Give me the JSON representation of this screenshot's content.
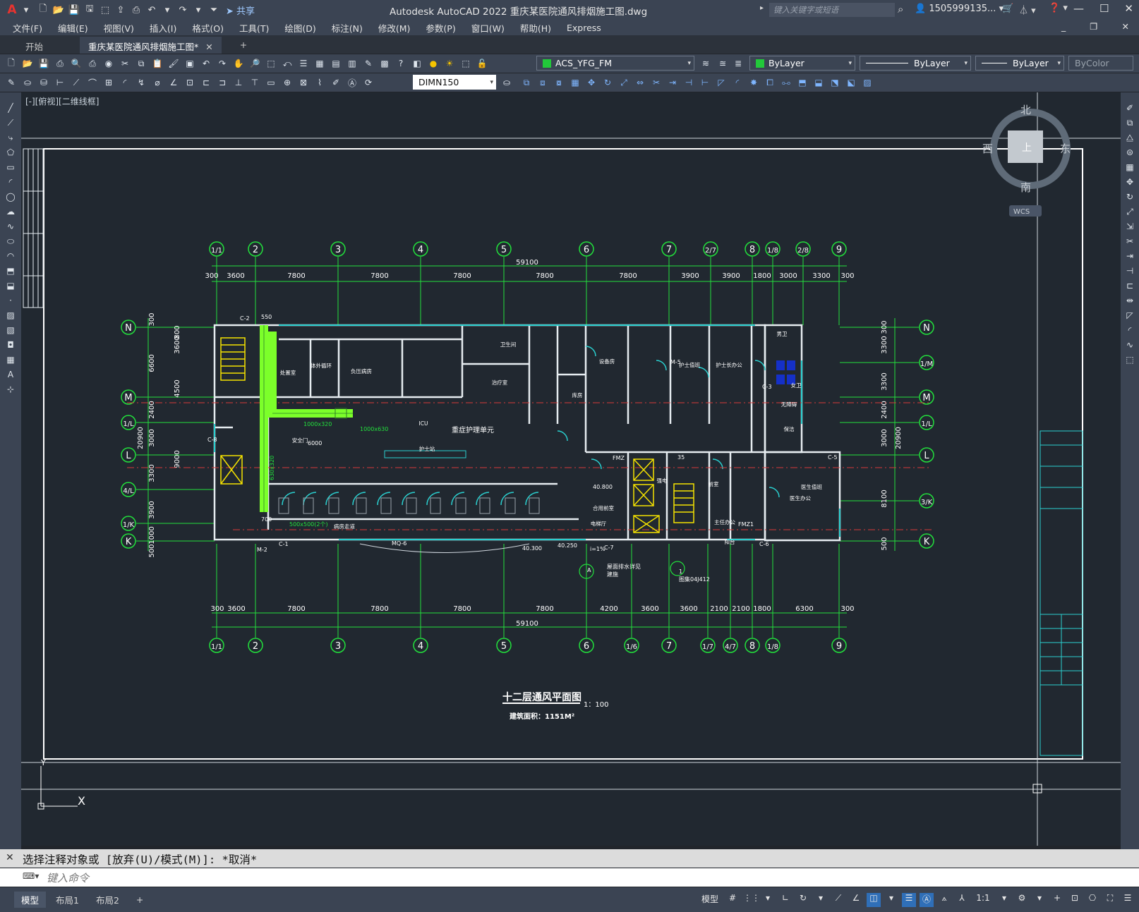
{
  "app": {
    "title": "Autodesk AutoCAD 2022    重庆某医院通风排烟施工图.dwg",
    "share_label": "共享",
    "search_placeholder": "键入关键字或短语",
    "user": "1505999135...",
    "logo": "A"
  },
  "menu": [
    "文件(F)",
    "编辑(E)",
    "视图(V)",
    "插入(I)",
    "格式(O)",
    "工具(T)",
    "绘图(D)",
    "标注(N)",
    "修改(M)",
    "参数(P)",
    "窗口(W)",
    "帮助(H)",
    "Express"
  ],
  "tabs": [
    {
      "label": "开始"
    },
    {
      "label": "重庆某医院通风排烟施工图*"
    }
  ],
  "toolbar": {
    "layer": "ACS_YFG_FM",
    "color": "ByLayer",
    "linetype": "ByLayer",
    "lineweight": "ByLayer",
    "plotstyle": "ByColor",
    "dimstyle": "DIMN150"
  },
  "viewport": {
    "label": "[-][俯视][二维线框]",
    "wcs": "WCS",
    "compass": {
      "n": "北",
      "s": "南",
      "e": "东",
      "w": "西",
      "top": "上"
    },
    "ucs_x": "X",
    "ucs_y": "Y"
  },
  "drawing": {
    "title": "十二层通风平面图",
    "scale": "1：100",
    "area": "建筑面积：1151M²",
    "top_axes": [
      "1/1",
      "2",
      "3",
      "4",
      "5",
      "6",
      "7",
      "2/7",
      "8",
      "1/8",
      "2/8",
      "9"
    ],
    "bottom_axes": [
      "1/1",
      "2",
      "3",
      "4",
      "5",
      "6",
      "1/6",
      "7",
      "1/7",
      "4/7",
      "8",
      "1/8",
      "9"
    ],
    "left_axes": [
      "N",
      "M",
      "1/L",
      "L",
      "4/L",
      "1/K",
      "K"
    ],
    "right_axes": [
      "N",
      "1/M",
      "M",
      "1/L",
      "L",
      "3/K",
      "K"
    ],
    "top_dims": [
      "300",
      "3600",
      "7800",
      "7800",
      "7800",
      "7800",
      "7800",
      "3900",
      "3900",
      "1800",
      "3000",
      "3300",
      "300"
    ],
    "bottom_dims": [
      "300",
      "3600",
      "7800",
      "7800",
      "7800",
      "7800",
      "4200",
      "3600",
      "3600",
      "2100",
      "2100",
      "1800",
      "6300",
      "300"
    ],
    "total": "59100",
    "left_dims": [
      "300",
      "800",
      "3600",
      "6600",
      "4500",
      "2400",
      "3000",
      "9000",
      "3300",
      "3900",
      "1000",
      "500",
      "20900"
    ],
    "right_dims": [
      "300",
      "3300",
      "3300",
      "2400",
      "3000",
      "8100",
      "500",
      "20900"
    ],
    "rooms": [
      "重症护理单元",
      "ICU",
      "护士站",
      "设备房",
      "护士值班",
      "护士长办公",
      "男卫",
      "女卫",
      "无障碍",
      "医生值班",
      "医生办公",
      "强电",
      "前室",
      "合用前室",
      "电梯厅",
      "病房走道",
      "阳台",
      "主任办公",
      "处置室",
      "体外循环",
      "库房",
      "治疗室",
      "负压病房",
      "卫生间",
      "安全门",
      "保洁"
    ],
    "ducts": [
      "1000x320",
      "1000x630",
      "500x500(2个)",
      "630x320"
    ],
    "misc": [
      "6000",
      "700",
      "550",
      "40.300",
      "40.250",
      "40.800",
      "i=1%",
      "C-1",
      "C-2",
      "C-3",
      "C-5",
      "C-6",
      "C-7",
      "C-8",
      "MQ-6",
      "M-2",
      "M-5",
      "FMZ1",
      "FMZ",
      "35",
      "1",
      "A",
      "图集04J412",
      "屋面排水详见",
      "建施"
    ]
  },
  "command": {
    "history": "选择注释对象或 [放弃(U)/模式(M)]: *取消*",
    "prompt": "键入命令"
  },
  "layout_tabs": [
    "模型",
    "布局1",
    "布局2"
  ],
  "status": {
    "model": "模型",
    "scale": "1:1"
  }
}
